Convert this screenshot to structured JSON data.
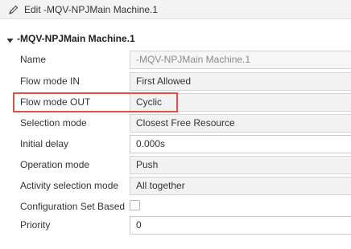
{
  "window": {
    "title": "Edit -MQV-NPJMain Machine.1",
    "edit_icon": "pencil-icon"
  },
  "section": {
    "title": "-MQV-NPJMain Machine.1",
    "toggle_icon": "caret-down-icon"
  },
  "properties": [
    {
      "key": "name",
      "label": "Name",
      "value": "-MQV-NPJMain Machine.1",
      "kind": "readonly"
    },
    {
      "key": "flow_mode_in",
      "label": "Flow mode IN",
      "value": "First Allowed",
      "kind": "select"
    },
    {
      "key": "flow_mode_out",
      "label": "Flow mode OUT",
      "value": "Cyclic",
      "kind": "select"
    },
    {
      "key": "selection_mode",
      "label": "Selection mode",
      "value": "Closest Free Resource",
      "kind": "select"
    },
    {
      "key": "initial_delay",
      "label": "Initial delay",
      "value": "0.000s",
      "kind": "input"
    },
    {
      "key": "operation_mode",
      "label": "Operation mode",
      "value": "Push",
      "kind": "select"
    },
    {
      "key": "activity_selection_mode",
      "label": "Activity selection mode",
      "value": "All together",
      "kind": "select"
    },
    {
      "key": "configuration_set_based",
      "label": "Configuration Set Based",
      "checked": false,
      "kind": "checkbox"
    },
    {
      "key": "priority",
      "label": "Priority",
      "value": "0",
      "kind": "input"
    }
  ],
  "colors": {
    "highlight": "#e05046"
  }
}
